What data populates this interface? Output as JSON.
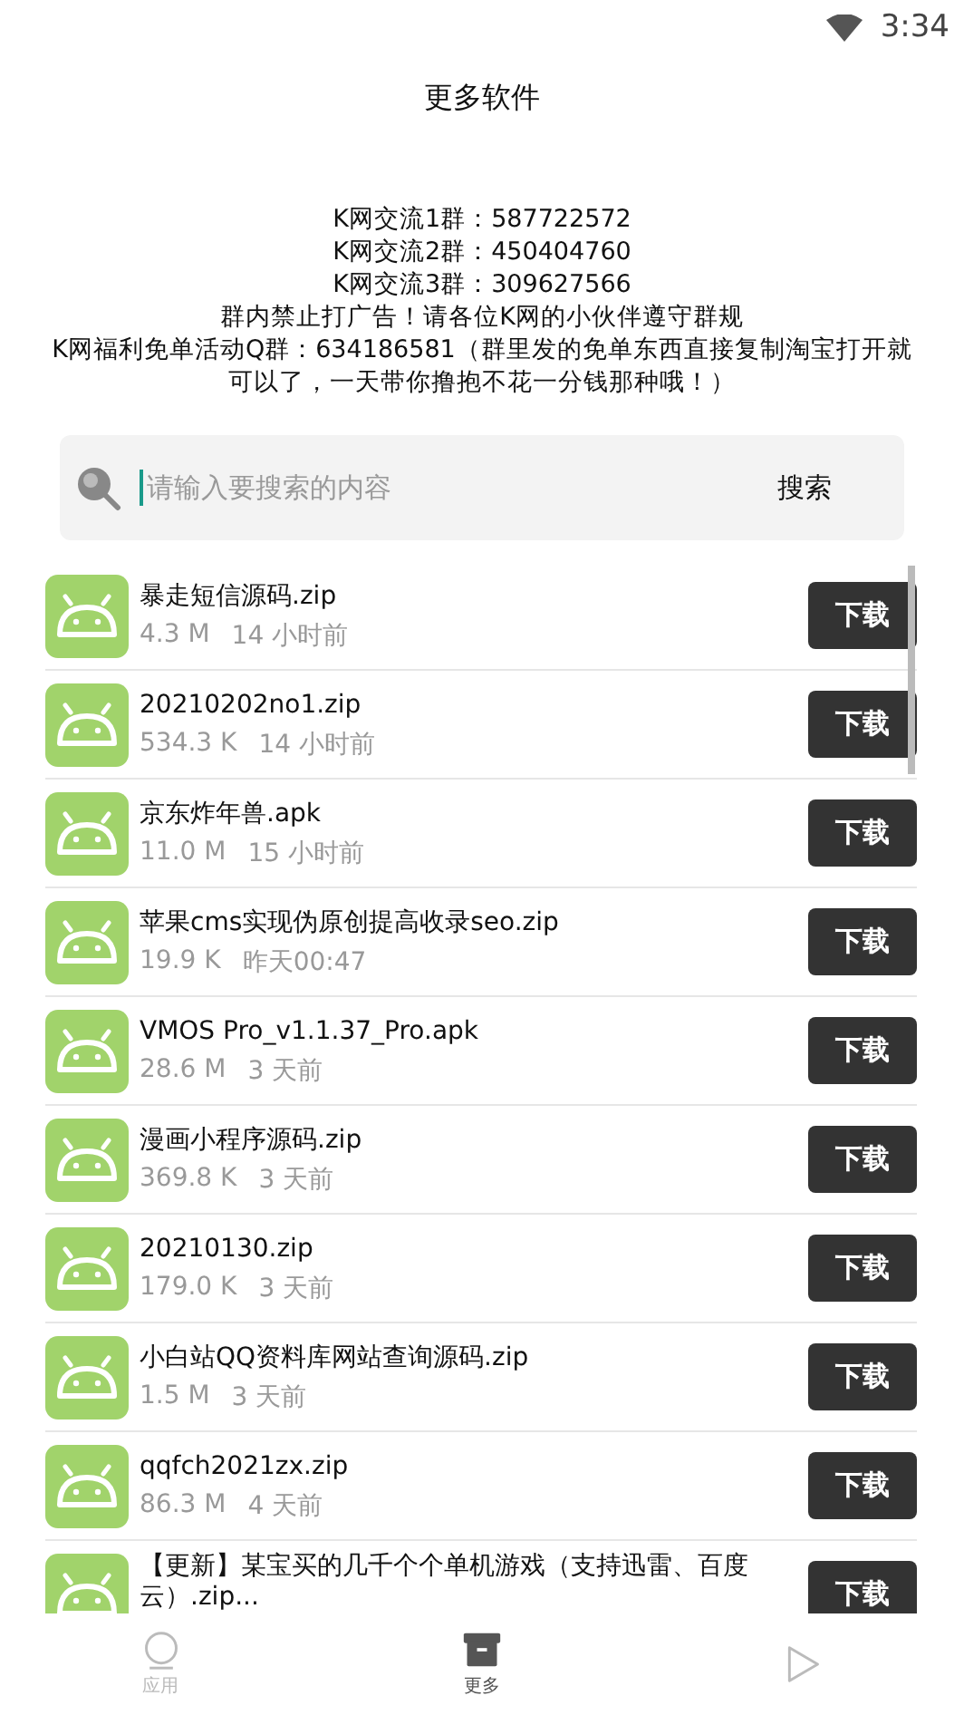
{
  "status_bar": {
    "time": "3:34"
  },
  "title": "更多软件",
  "notice": [
    "K网交流1群：587722572",
    "K网交流2群：450404760",
    "K网交流3群：309627566",
    "群内禁止打广告！请各位K网的小伙伴遵守群规",
    "K网福利免单活动Q群：634186581（群里发的免单东西直接复制淘宝打开就可以了，一天带你撸抱不花一分钱那种哦！）"
  ],
  "search": {
    "placeholder": "请输入要搜索的内容",
    "button": "搜索"
  },
  "files": [
    {
      "name": "暴走短信源码.zip",
      "size": "4.3 M",
      "time": "14 小时前",
      "button": "下载"
    },
    {
      "name": "20210202no1.zip",
      "size": "534.3 K",
      "time": "14 小时前",
      "button": "下载"
    },
    {
      "name": "京东炸年兽.apk",
      "size": "11.0 M",
      "time": "15 小时前",
      "button": "下载"
    },
    {
      "name": "苹果cms实现伪原创提高收录seo.zip",
      "size": "19.9 K",
      "time": "昨天00:47",
      "button": "下载"
    },
    {
      "name": "VMOS Pro_v1.1.37_Pro.apk",
      "size": "28.6 M",
      "time": "3 天前",
      "button": "下载"
    },
    {
      "name": "漫画小程序源码.zip",
      "size": "369.8 K",
      "time": "3 天前",
      "button": "下载"
    },
    {
      "name": "20210130.zip",
      "size": "179.0 K",
      "time": "3 天前",
      "button": "下载"
    },
    {
      "name": "小白站QQ资料库网站查询源码.zip",
      "size": "1.5 M",
      "time": "3 天前",
      "button": "下载"
    },
    {
      "name": "qqfch2021zx.zip",
      "size": "86.3 M",
      "time": "4 天前",
      "button": "下载"
    },
    {
      "name": "【更新】某宝买的几千个个单机游戏（支持迅雷、百度云）.zip...",
      "button": "下载"
    }
  ],
  "nav": [
    {
      "kind": "circle",
      "label": "应用",
      "selected": false
    },
    {
      "kind": "box",
      "label": "更多",
      "selected": true
    },
    {
      "kind": "play",
      "selected": false
    }
  ]
}
